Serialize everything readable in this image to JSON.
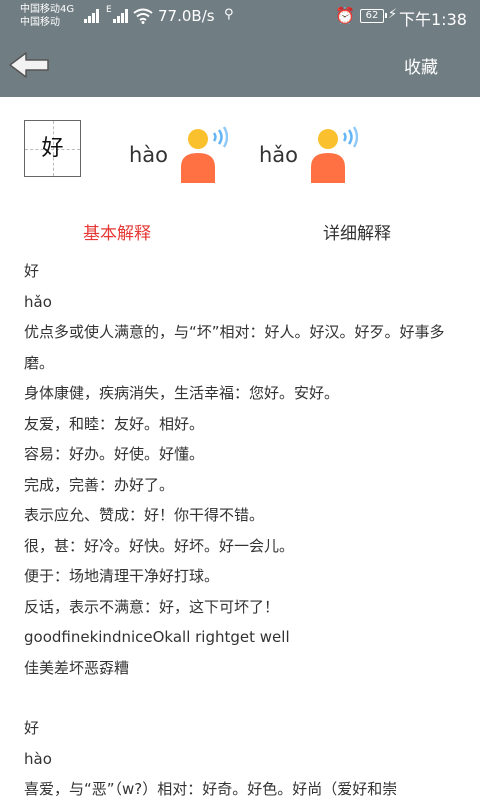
{
  "status": {
    "carrier1": "中国移动4G",
    "carrier2": "中国移动",
    "net_label": "E",
    "speed": "77.0B/s",
    "battery": "62",
    "time": "下午1:38"
  },
  "toolbar": {
    "favorite_label": "收藏"
  },
  "character": "好",
  "pronunciations": [
    {
      "pinyin": "hào"
    },
    {
      "pinyin": "hǎo"
    }
  ],
  "tabs": {
    "basic": "基本解释",
    "detail": "详细解释"
  },
  "entries": [
    {
      "char": "好",
      "pinyin": "hǎo",
      "lines": [
        "优点多或使人满意的，与“坏”相对：好人。好汉。好歹。好事多",
        "磨。",
        "身体康健，疾病消失，生活幸福：您好。安好。",
        "友爱，和睦：友好。相好。",
        "容易：好办。好使。好懂。",
        "完成，完善：办好了。",
        "表示应允、赞成：好！你干得不错。",
        "很，甚：好冷。好快。好坏。好一会儿。",
        "便于：场地清理干净好打球。",
        "反话，表示不满意：好，这下可坏了！",
        "goodfinekindniceOkall rightget well",
        "佳美差坏恶孬糟"
      ]
    },
    {
      "char": "好",
      "pinyin": "hào",
      "lines": [
        "喜爱，与“恶”（w?）相对：好奇。好色。好尚（爱好和崇"
      ]
    }
  ],
  "colors": {
    "header": "#707d83",
    "active_tab": "#e53935"
  }
}
